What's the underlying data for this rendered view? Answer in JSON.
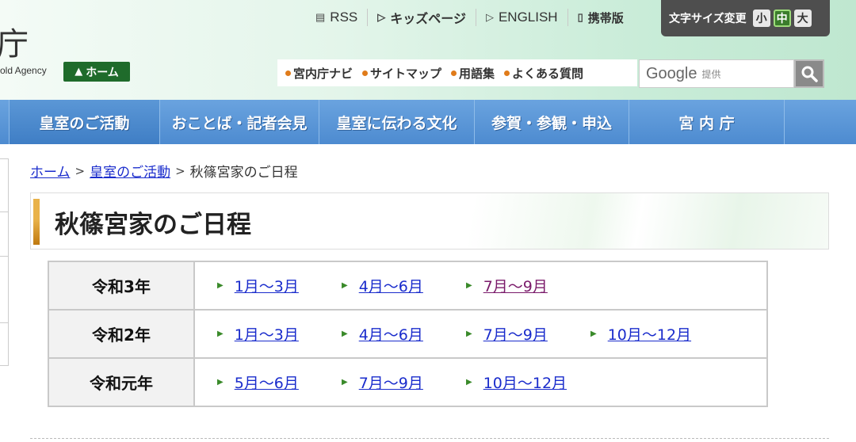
{
  "header": {
    "logo_char": "庁",
    "logo_sub": "old Agency",
    "home_badge": "ホーム",
    "util_links": [
      {
        "label": "RSS",
        "icon": "rss-icon"
      },
      {
        "label": "キッズページ",
        "icon": "play-icon"
      },
      {
        "label": "ENGLISH",
        "icon": "play-icon"
      },
      {
        "label": "携帯版",
        "icon": "mobile-icon"
      }
    ],
    "font_size": {
      "label": "文字サイズ変更",
      "small": "小",
      "medium": "中",
      "large": "大",
      "selected": "中"
    },
    "sub_links": [
      "宮内庁ナビ",
      "サイトマップ",
      "用語集",
      "よくある質問"
    ],
    "search": {
      "brand": "Google",
      "provided": "提供",
      "button_icon": "search-icon"
    }
  },
  "nav": {
    "items": [
      "皇室のご活動",
      "おことば・記者会見",
      "皇室に伝わる文化",
      "参賀・参観・申込",
      "宮 内 庁"
    ],
    "active_index": 0
  },
  "breadcrumb": {
    "home": "ホーム",
    "parent": "皇室のご活動",
    "current": "秋篠宮家のご日程",
    "separator": ">"
  },
  "page": {
    "title": "秋篠宮家のご日程"
  },
  "schedule": [
    {
      "year": "令和3年",
      "periods": [
        {
          "label": "1月～3月",
          "visited": false
        },
        {
          "label": "4月～6月",
          "visited": false
        },
        {
          "label": "7月～9月",
          "visited": true
        }
      ]
    },
    {
      "year": "令和2年",
      "periods": [
        {
          "label": "1月～3月",
          "visited": false
        },
        {
          "label": "4月～6月",
          "visited": false
        },
        {
          "label": "7月～9月",
          "visited": false
        },
        {
          "label": "10月～12月",
          "visited": false
        }
      ]
    },
    {
      "year": "令和元年",
      "periods": [
        {
          "label": "5月～6月",
          "visited": false
        },
        {
          "label": "7月～9月",
          "visited": false
        },
        {
          "label": "10月～12月",
          "visited": false
        }
      ]
    }
  ],
  "colors": {
    "nav": "#4d8bd0",
    "link": "#1a2ccc",
    "visited_link": "#7a1a6a",
    "accent_orange": "#e07b1a",
    "home_green": "#1f6b2b"
  }
}
